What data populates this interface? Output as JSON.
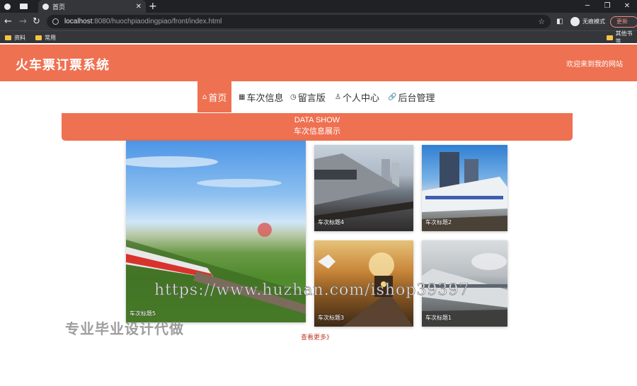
{
  "browser": {
    "tabs": [
      {
        "label": "首页",
        "active": true
      }
    ],
    "url_host": "localhost",
    "url_path": ":8080/huochpiaodingpiao/front/index.html",
    "incognito_label": "无痕模式",
    "update_label": "更新",
    "bookmarks": [
      "资料",
      "常用",
      "其他书签"
    ]
  },
  "header": {
    "title": "火车票订票系统",
    "welcome": "欢迎来到我的网站"
  },
  "nav": {
    "items": [
      {
        "label": "首页",
        "icon": "home-icon",
        "active": true
      },
      {
        "label": "车次信息",
        "icon": "grid-icon",
        "active": false
      },
      {
        "label": "留言版",
        "icon": "clock-icon",
        "active": false
      },
      {
        "label": "个人中心",
        "icon": "user-icon",
        "active": false
      },
      {
        "label": "后台管理",
        "icon": "link-icon",
        "active": false
      }
    ]
  },
  "banner": {
    "en": "DATA SHOW",
    "zh": "车次信息展示"
  },
  "cards": [
    {
      "caption": "车次标题5"
    },
    {
      "caption": "车次标题4"
    },
    {
      "caption": "车次标题2"
    },
    {
      "caption": "车次标题3"
    },
    {
      "caption": "车次标题1"
    }
  ],
  "more_label": "查看更多》",
  "overlay": {
    "url_watermark": "https://www.huzhan.com/ishop39397",
    "zh_watermark": "专业毕业设计代做"
  },
  "colors": {
    "brand": "#ee7151",
    "chrome_dark": "#202124"
  }
}
